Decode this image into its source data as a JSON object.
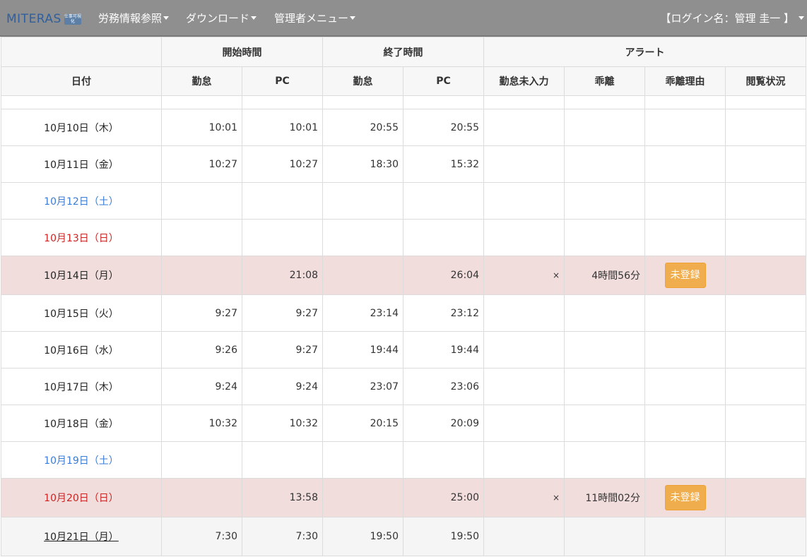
{
  "header": {
    "logo_text": "MITERAS",
    "logo_badge": "仕事可視化",
    "nav": [
      "労務情報参照",
      "ダウンロード",
      "管理者メニュー"
    ],
    "login": "【ログイン名：管理 圭一 】"
  },
  "table": {
    "group_headers": {
      "start": "開始時間",
      "end": "終了時間",
      "alert": "アラート"
    },
    "col_headers": {
      "date": "日付",
      "start_kintai": "勤怠",
      "start_pc": "PC",
      "end_kintai": "勤怠",
      "end_pc": "PC",
      "missing": "勤怠未入力",
      "divergence": "乖離",
      "reason": "乖離理由",
      "viewed": "閲覧状況"
    },
    "rows": [
      {
        "date": "10月10日（木）",
        "s_k": "10:01",
        "s_pc": "10:01",
        "e_k": "20:55",
        "e_pc": "20:55",
        "missing": "",
        "div": "",
        "reason": "",
        "view": ""
      },
      {
        "date": "10月11日（金）",
        "s_k": "10:27",
        "s_pc": "10:27",
        "e_k": "18:30",
        "e_pc": "15:32",
        "missing": "",
        "div": "",
        "reason": "",
        "view": ""
      },
      {
        "date": "10月12日（土）",
        "s_k": "",
        "s_pc": "",
        "e_k": "",
        "e_pc": "",
        "missing": "",
        "div": "",
        "reason": "",
        "view": ""
      },
      {
        "date": "10月13日（日）",
        "s_k": "",
        "s_pc": "",
        "e_k": "",
        "e_pc": "",
        "missing": "",
        "div": "",
        "reason": "",
        "view": ""
      },
      {
        "date": "10月14日（月）",
        "s_k": "",
        "s_pc": "21:08",
        "e_k": "",
        "e_pc": "26:04",
        "missing": "×",
        "div": "4時間56分",
        "reason": "未登録",
        "view": ""
      },
      {
        "date": "10月15日（火）",
        "s_k": "9:27",
        "s_pc": "9:27",
        "e_k": "23:14",
        "e_pc": "23:12",
        "missing": "",
        "div": "",
        "reason": "",
        "view": ""
      },
      {
        "date": "10月16日（水）",
        "s_k": "9:26",
        "s_pc": "9:27",
        "e_k": "19:44",
        "e_pc": "19:44",
        "missing": "",
        "div": "",
        "reason": "",
        "view": ""
      },
      {
        "date": "10月17日（木）",
        "s_k": "9:24",
        "s_pc": "9:24",
        "e_k": "23:07",
        "e_pc": "23:06",
        "missing": "",
        "div": "",
        "reason": "",
        "view": ""
      },
      {
        "date": "10月18日（金）",
        "s_k": "10:32",
        "s_pc": "10:32",
        "e_k": "20:15",
        "e_pc": "20:09",
        "missing": "",
        "div": "",
        "reason": "",
        "view": ""
      },
      {
        "date": "10月19日（土）",
        "s_k": "",
        "s_pc": "",
        "e_k": "",
        "e_pc": "",
        "missing": "",
        "div": "",
        "reason": "",
        "view": ""
      },
      {
        "date": "10月20日（日）",
        "s_k": "",
        "s_pc": "13:58",
        "e_k": "",
        "e_pc": "25:00",
        "missing": "×",
        "div": "11時間02分",
        "reason": "未登録",
        "view": ""
      },
      {
        "date": "10月21日（月）",
        "s_k": "7:30",
        "s_pc": "7:30",
        "e_k": "19:50",
        "e_pc": "19:50",
        "missing": "",
        "div": "",
        "reason": "",
        "view": ""
      }
    ]
  },
  "colors": {
    "navbar": "#8f8f8f",
    "saturday": "#3a7bd5",
    "sunday": "#cc2222",
    "alert_row": "#f2dddd",
    "button": "#f0ad4e"
  }
}
